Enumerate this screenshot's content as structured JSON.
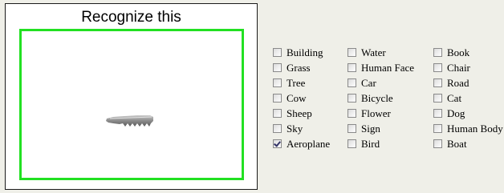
{
  "viewer": {
    "title": "Recognize this",
    "frame_color": "#22e022"
  },
  "categories": {
    "columns": [
      [
        {
          "label": "Building",
          "checked": false
        },
        {
          "label": "Grass",
          "checked": false
        },
        {
          "label": "Tree",
          "checked": false
        },
        {
          "label": "Cow",
          "checked": false
        },
        {
          "label": "Sheep",
          "checked": false
        },
        {
          "label": "Sky",
          "checked": false
        },
        {
          "label": "Aeroplane",
          "checked": true
        }
      ],
      [
        {
          "label": "Water",
          "checked": false
        },
        {
          "label": "Human Face",
          "checked": false
        },
        {
          "label": "Car",
          "checked": false
        },
        {
          "label": "Bicycle",
          "checked": false
        },
        {
          "label": "Flower",
          "checked": false
        },
        {
          "label": "Sign",
          "checked": false
        },
        {
          "label": "Bird",
          "checked": false
        }
      ],
      [
        {
          "label": "Book",
          "checked": false
        },
        {
          "label": "Chair",
          "checked": false
        },
        {
          "label": "Road",
          "checked": false
        },
        {
          "label": "Cat",
          "checked": false
        },
        {
          "label": "Dog",
          "checked": false
        },
        {
          "label": "Human Body",
          "checked": false
        },
        {
          "label": "Boat",
          "checked": false
        }
      ]
    ]
  }
}
